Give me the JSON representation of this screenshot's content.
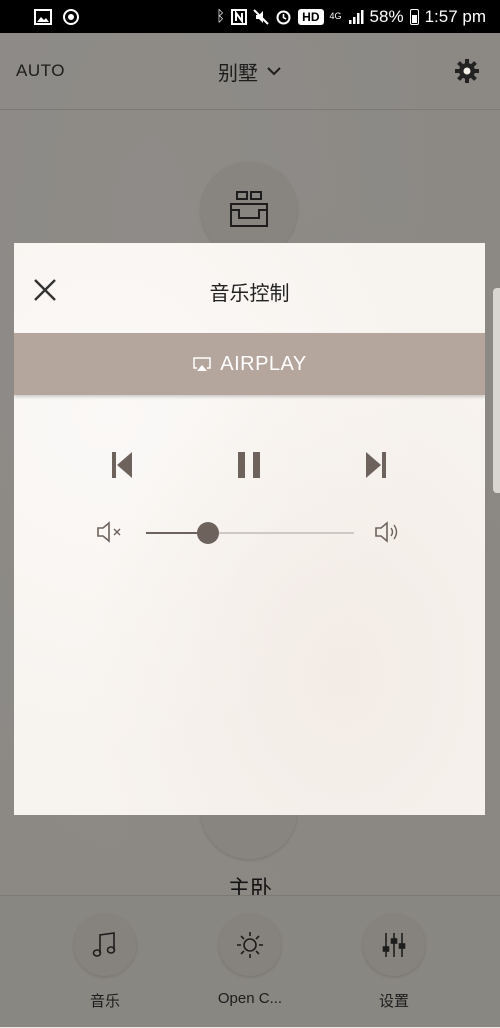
{
  "status_bar": {
    "network_type": "4G",
    "hd_badge": "HD",
    "battery_percent": "58%",
    "time": "1:57 pm",
    "icons": [
      "gallery-icon",
      "sync-icon",
      "bluetooth-icon",
      "nfc-icon",
      "mute-icon",
      "alarm-icon",
      "signal-icon",
      "battery-icon"
    ]
  },
  "app": {
    "header": {
      "mode_label": "AUTO",
      "location_title": "别墅"
    },
    "room_label": "主卧",
    "nav": [
      {
        "label": "音乐",
        "icon": "music-note-icon"
      },
      {
        "label": "Open C...",
        "icon": "light-icon"
      },
      {
        "label": "设置",
        "icon": "equalizer-icon"
      }
    ]
  },
  "modal": {
    "title": "音乐控制",
    "airplay_label": "AIRPLAY",
    "volume_level": 0.3
  },
  "colors": {
    "accent_bar": "#b5a69d",
    "control": "#6e635c",
    "track": "#cfc9c3"
  }
}
